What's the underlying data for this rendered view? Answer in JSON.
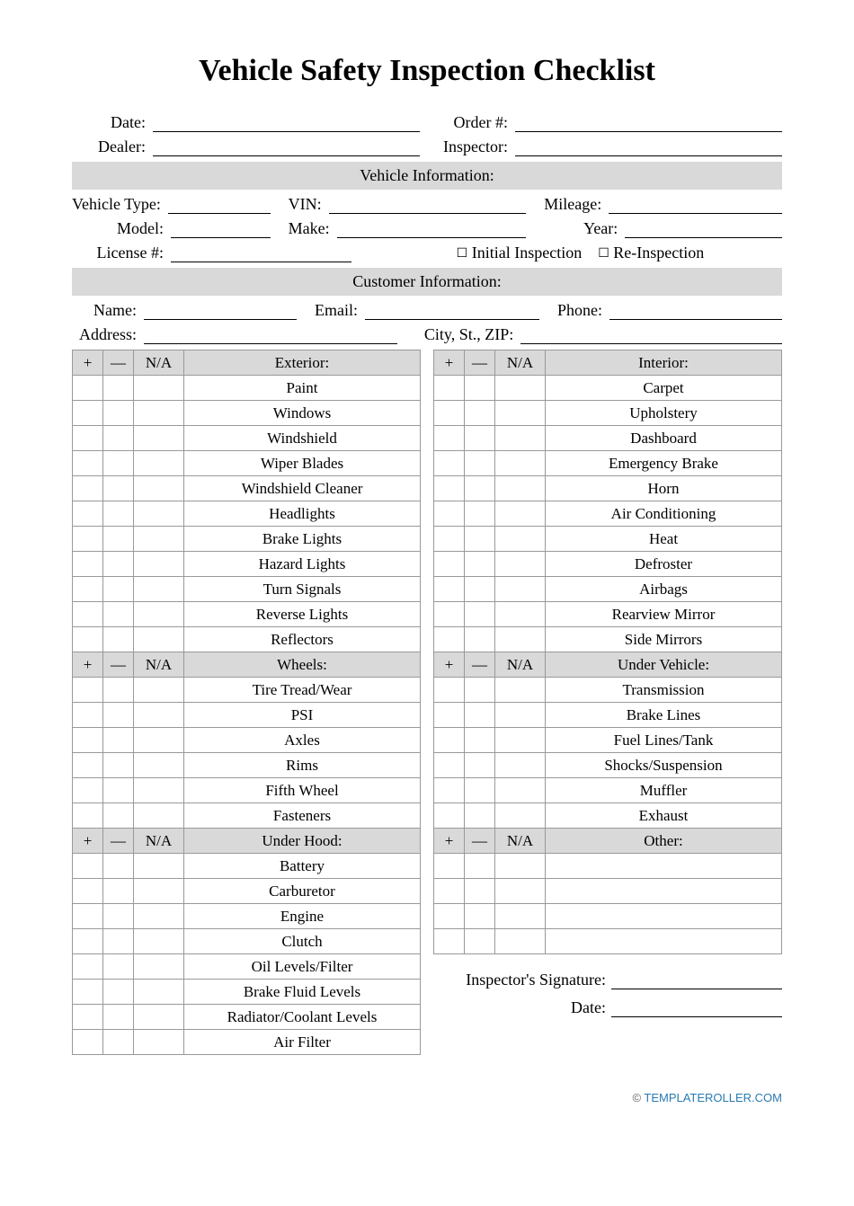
{
  "title": "Vehicle Safety Inspection Checklist",
  "top_fields": {
    "date": "Date:",
    "order": "Order #:",
    "dealer": "Dealer:",
    "inspector": "Inspector:"
  },
  "vehicle_section": {
    "header": "Vehicle Information:",
    "vehicle_type": "Vehicle Type:",
    "vin": "VIN:",
    "mileage": "Mileage:",
    "model": "Model:",
    "make": "Make:",
    "year": "Year:",
    "license": "License #:",
    "initial": "Initial Inspection",
    "reinspect": "Re-Inspection"
  },
  "customer_section": {
    "header": "Customer Information:",
    "name": "Name:",
    "email": "Email:",
    "phone": "Phone:",
    "address": "Address:",
    "city": "City, St., ZIP:"
  },
  "col_headers": {
    "plus": "+",
    "minus": "—",
    "na": "N/A"
  },
  "checklist_left": [
    {
      "title": "Exterior:",
      "items": [
        "Paint",
        "Windows",
        "Windshield",
        "Wiper Blades",
        "Windshield Cleaner",
        "Headlights",
        "Brake Lights",
        "Hazard Lights",
        "Turn Signals",
        "Reverse Lights",
        "Reflectors"
      ]
    },
    {
      "title": "Wheels:",
      "items": [
        "Tire Tread/Wear",
        "PSI",
        "Axles",
        "Rims",
        "Fifth Wheel",
        "Fasteners"
      ]
    },
    {
      "title": "Under Hood:",
      "items": [
        "Battery",
        "Carburetor",
        "Engine",
        "Clutch",
        "Oil Levels/Filter",
        "Brake Fluid Levels",
        "Radiator/Coolant Levels",
        "Air Filter"
      ]
    }
  ],
  "checklist_right": [
    {
      "title": "Interior:",
      "items": [
        "Carpet",
        "Upholstery",
        "Dashboard",
        "Emergency Brake",
        "Horn",
        "Air Conditioning",
        "Heat",
        "Defroster",
        "Airbags",
        "Rearview Mirror",
        "Side Mirrors"
      ]
    },
    {
      "title": "Under Vehicle:",
      "items": [
        "Transmission",
        "Brake Lines",
        "Fuel Lines/Tank",
        "Shocks/Suspension",
        "Muffler",
        "Exhaust"
      ]
    },
    {
      "title": "Other:",
      "items": [
        "",
        "",
        "",
        ""
      ]
    }
  ],
  "signature": {
    "sig": "Inspector's Signature:",
    "date": "Date:"
  },
  "footer": {
    "copy": "©",
    "link": "TEMPLATEROLLER.COM"
  }
}
